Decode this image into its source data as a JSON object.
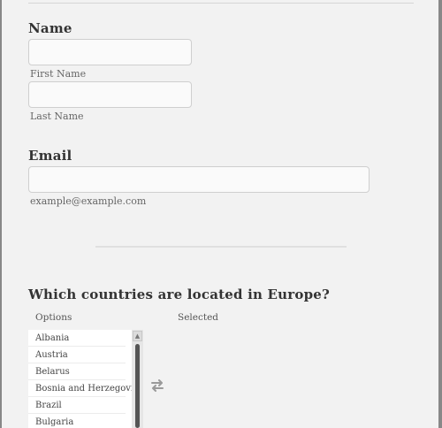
{
  "name_section": {
    "label": "Name",
    "first_name": {
      "value": "",
      "sublabel": "First Name"
    },
    "last_name": {
      "value": "",
      "sublabel": "Last Name"
    }
  },
  "email_section": {
    "label": "Email",
    "value": "",
    "sublabel": "example@example.com"
  },
  "question": {
    "label": "Which countries are located in Europe?",
    "options_header": "Options",
    "selected_header": "Selected",
    "options": [
      "Albania",
      "Austria",
      "Belarus",
      "Bosnia and Herzegovina",
      "Brazil",
      "Bulgaria"
    ],
    "scroll_up_glyph": "▲"
  }
}
